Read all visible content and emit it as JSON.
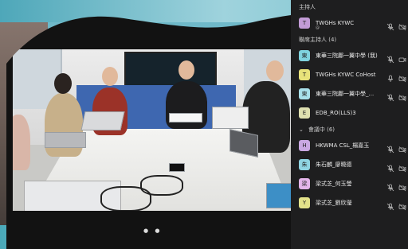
{
  "panel": {
    "host_title": "主持人",
    "cohost_title": "聯席主持人 (4)",
    "meeting_title": "會議中 (6)",
    "host": {
      "initial": "T",
      "name": "TWGHs KYWC",
      "sub": "@",
      "color": "#c29bd6"
    },
    "cohosts": [
      {
        "initial": "東",
        "name": "東華三院鄺一翼中學 (我)",
        "color": "#7fd3df"
      },
      {
        "initial": "T",
        "name": "TWGHs KYWC CoHost",
        "color": "#e8e27a"
      },
      {
        "initial": "東",
        "name": "東華三院鄺一翼中學_...",
        "color": "#a8e0ea"
      },
      {
        "initial": "E",
        "name": "EDB_RO(LLS)3",
        "color": "#dfe0b0"
      }
    ],
    "participants": [
      {
        "initial": "H",
        "name": "HKWMA CSL_楊嘉玉",
        "color": "#c9a8e2"
      },
      {
        "initial": "朱",
        "name": "朱石麟_廖曉德",
        "color": "#8fd4e2"
      },
      {
        "initial": "梁",
        "name": "梁式芝_何玉瑩",
        "color": "#e3b5ea"
      },
      {
        "initial": "Y",
        "name": "梁式芝_劉欣瀅",
        "color": "#e3e28a"
      }
    ]
  },
  "icons": {
    "mic": "microphone-icon",
    "cam": "camera-icon",
    "chevron": "chevron-down-icon"
  },
  "video": {
    "pager_dots": "● ●"
  }
}
